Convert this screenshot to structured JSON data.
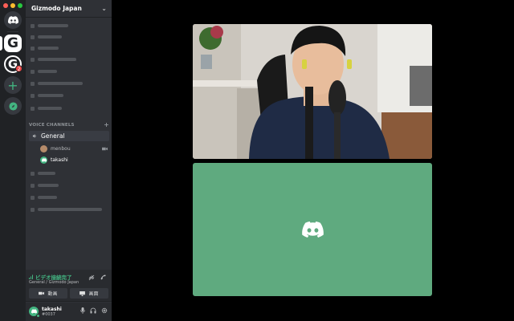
{
  "window": {
    "traffic_lights": [
      "#ff5f57",
      "#febc2e",
      "#28c840"
    ]
  },
  "rail": {
    "servers": [
      {
        "id": "home",
        "icon": "discord-logo-icon"
      },
      {
        "id": "gizmodo-japan",
        "letter": "G",
        "selected": true
      },
      {
        "id": "server-g2",
        "letter": "G",
        "badge": "2"
      },
      {
        "id": "add-server",
        "glyph": "+"
      },
      {
        "id": "explore",
        "icon": "compass-icon"
      }
    ]
  },
  "server": {
    "name": "Gizmodo Japan",
    "chevron": "⌄"
  },
  "voice_category": {
    "label": "VOICE CHANNELS",
    "add": "+"
  },
  "voice_channel": {
    "name": "General",
    "members": [
      {
        "name": "menbou",
        "camera": true
      },
      {
        "name": "takashi",
        "camera": false
      }
    ]
  },
  "voice_panel": {
    "status": "ビデオ接続完了",
    "location": "General / Gizmodo Japan",
    "video_button": "動画",
    "screen_button": "画面"
  },
  "user": {
    "name": "takashi",
    "tag": "#0037"
  },
  "colors": {
    "accent_green": "#43b581",
    "avatar_tile": "#5faa7f",
    "sidebar": "#2f3136",
    "rail": "#202225"
  }
}
